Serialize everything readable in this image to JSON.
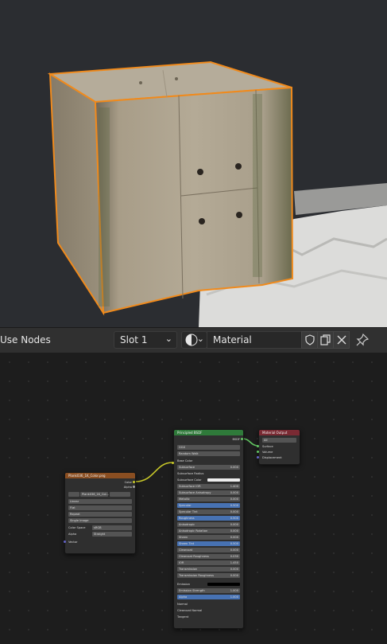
{
  "header": {
    "use_nodes_label": "Use Nodes",
    "slot_value": "Slot 1",
    "material_name": "Material"
  },
  "image_node": {
    "title": "Plank036_1K_Color.png",
    "image_name": "Plank036_1K_Col...",
    "outputs": [
      "Color",
      "Alpha"
    ],
    "interpolation": "Linear",
    "projection": "Flat",
    "extension": "Repeat",
    "source": "Single Image",
    "color_space_label": "Color Space",
    "color_space_value": "sRGB",
    "alpha_label": "Alpha",
    "alpha_value": "Straight",
    "vector_label": "Vector"
  },
  "bsdf_node": {
    "title": "Principled BSDF",
    "output": "BSDF",
    "distribution": "GGX",
    "subsurface_method": "Random Walk",
    "base_color_label": "Base Color",
    "subsurface_color_label": "Subsurface Color",
    "subsurface_radius_label": "Subsurface Radius",
    "emission_label": "Emission",
    "normal_label": "Normal",
    "clearcoat_normal_label": "Clearcoat Normal",
    "tangent_label": "Tangent",
    "fields": [
      {
        "label": "Subsurface",
        "value": "0.000"
      },
      {
        "label": "Subsurface IOR",
        "value": "1.400"
      },
      {
        "label": "Subsurface Anisotropy",
        "value": "0.000"
      },
      {
        "label": "Metallic",
        "value": "0.000"
      },
      {
        "label": "Specular",
        "value": "0.500"
      },
      {
        "label": "Specular Tint",
        "value": "0.000"
      },
      {
        "label": "Roughness",
        "value": "0.500"
      },
      {
        "label": "Anisotropic",
        "value": "0.000"
      },
      {
        "label": "Anisotropic Rotation",
        "value": "0.000"
      },
      {
        "label": "Sheen",
        "value": "0.000"
      },
      {
        "label": "Sheen Tint",
        "value": "0.500"
      },
      {
        "label": "Clearcoat",
        "value": "0.000"
      },
      {
        "label": "Clearcoat Roughness",
        "value": "0.030"
      },
      {
        "label": "IOR",
        "value": "1.450"
      },
      {
        "label": "Transmission",
        "value": "0.000"
      },
      {
        "label": "Transmission Roughness",
        "value": "0.000"
      }
    ],
    "fields2": [
      {
        "label": "Emission Strength",
        "value": "1.000"
      },
      {
        "label": "Alpha",
        "value": "1.000"
      }
    ]
  },
  "output_node": {
    "title": "Material Output",
    "target": "All",
    "inputs": [
      "Surface",
      "Volume",
      "Displacement"
    ]
  }
}
